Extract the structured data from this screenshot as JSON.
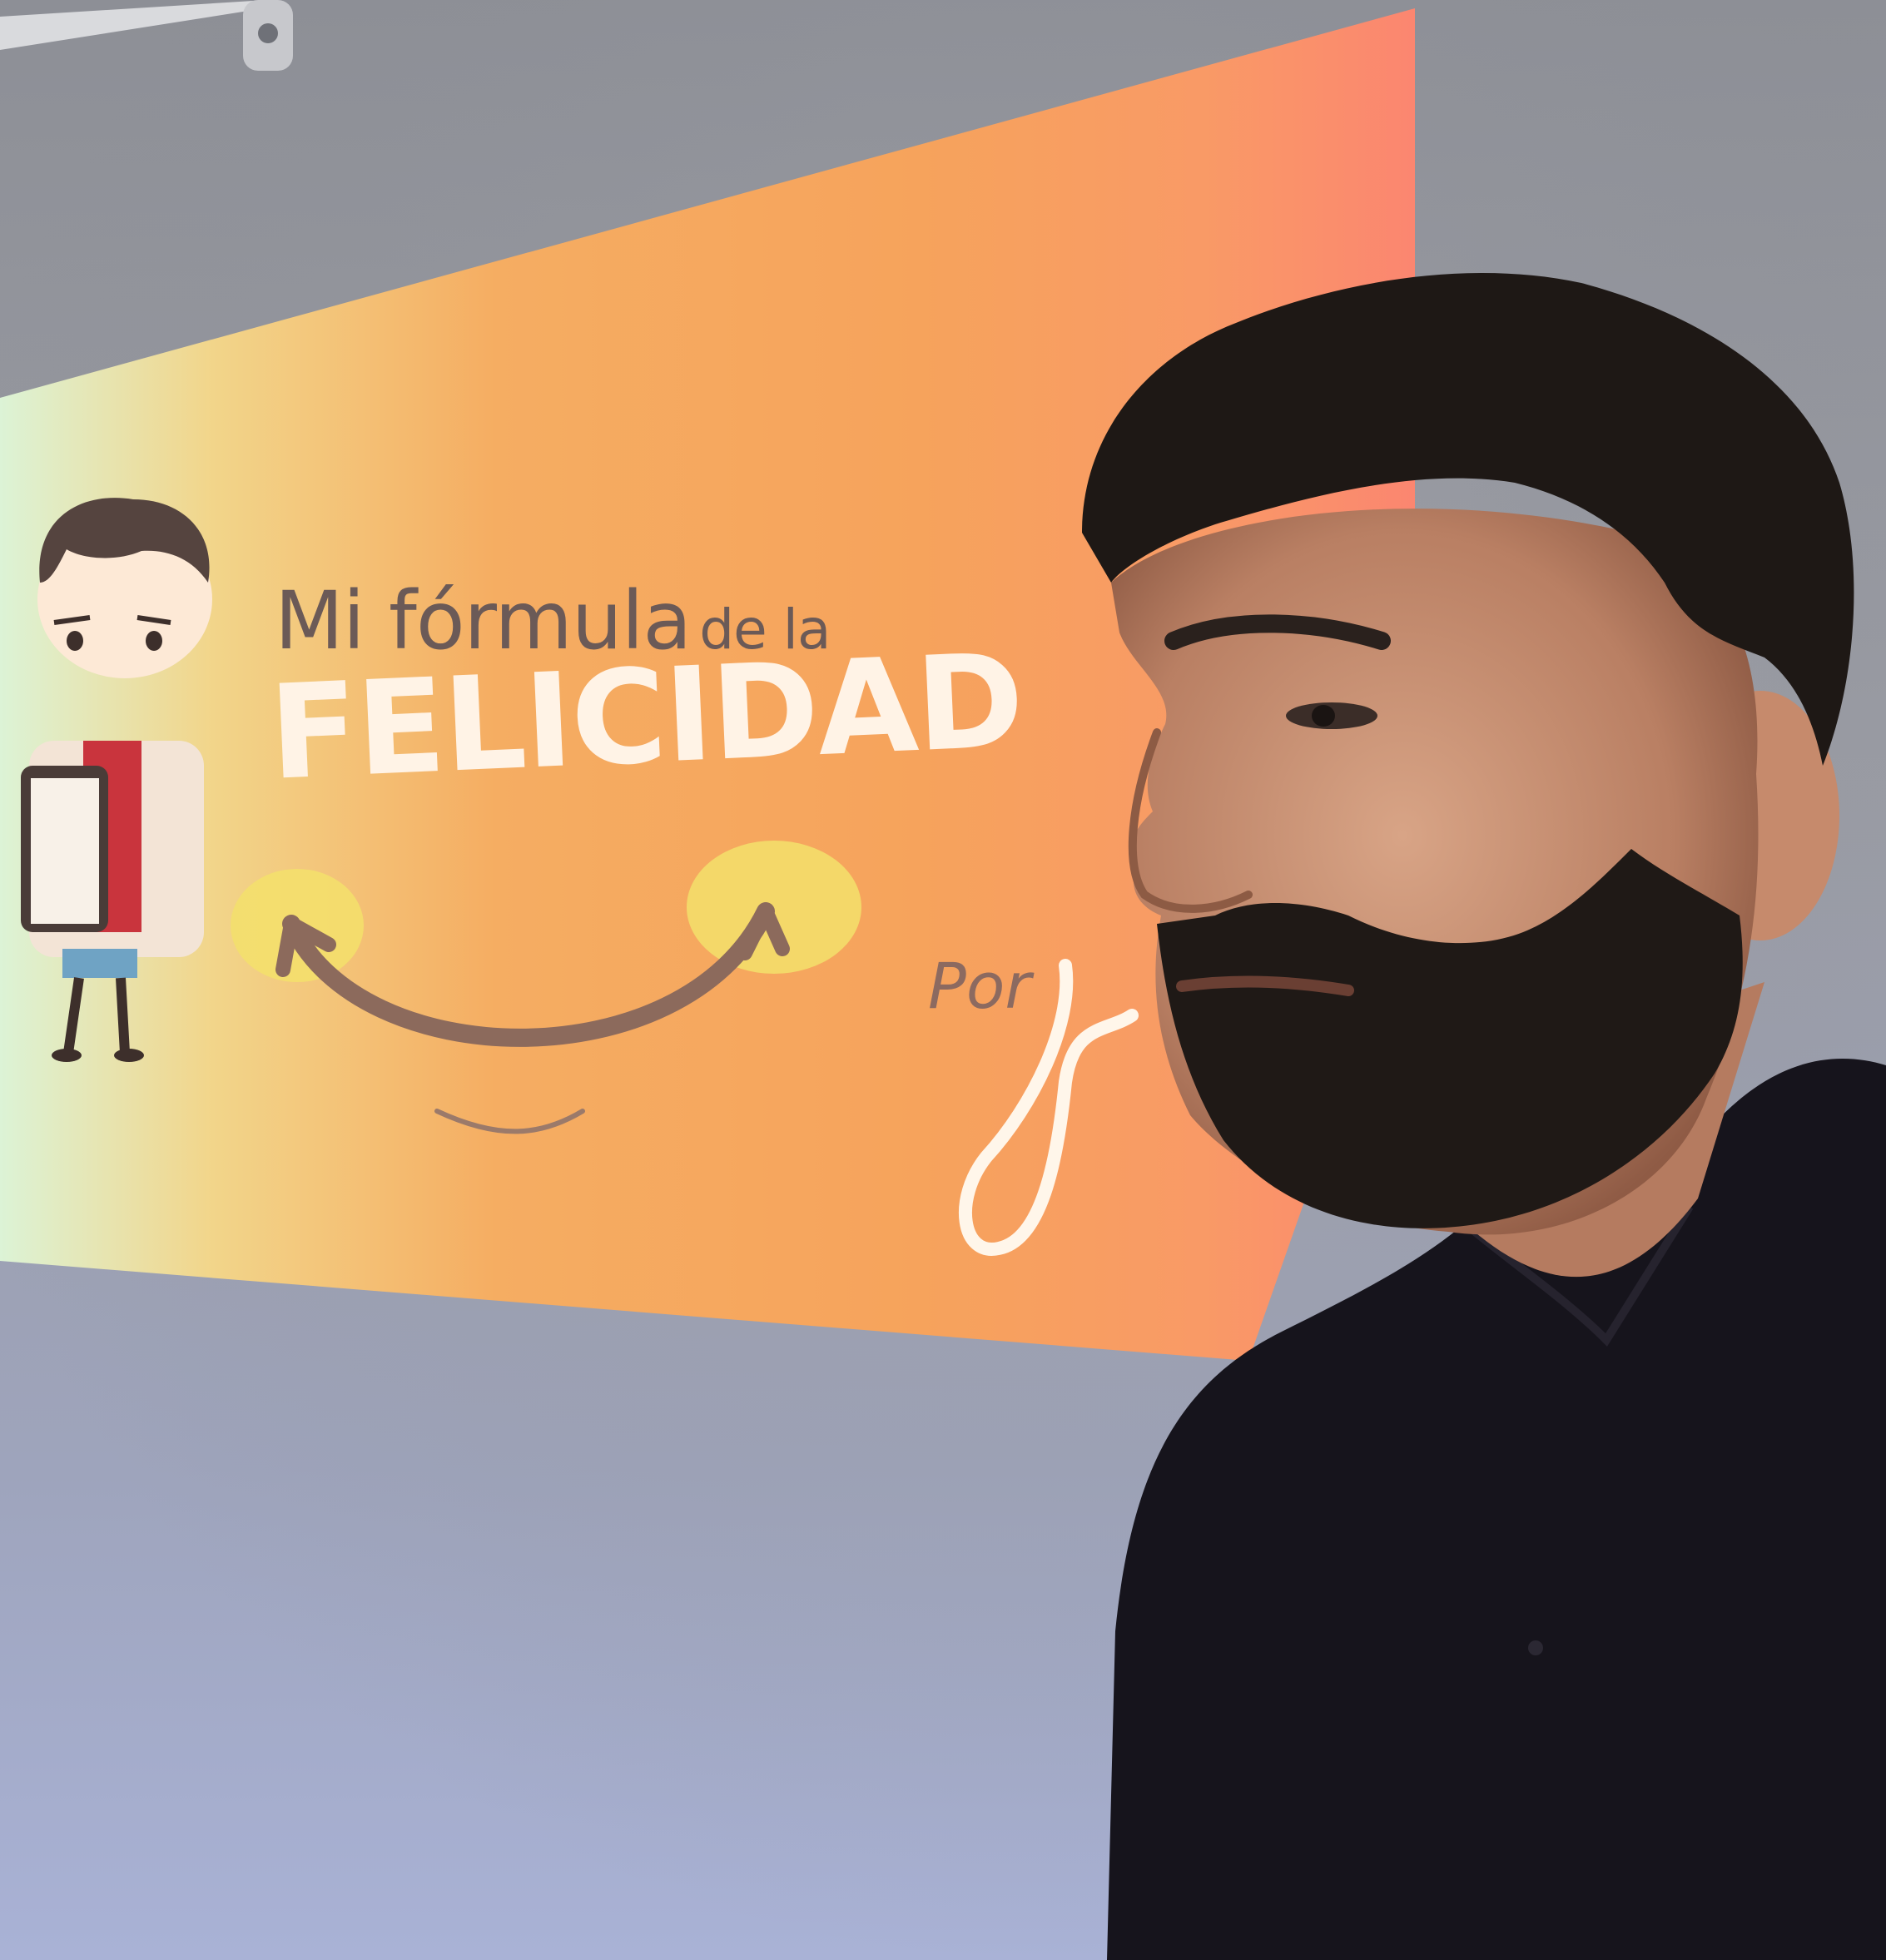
{
  "slide": {
    "title_prefix": "Mi fórmula",
    "title_suffix": "de la",
    "title_main": "FELICIDAD",
    "byline": "Por"
  },
  "colors": {
    "wall": "#9a9ca4",
    "slide_left": "#dff2d2",
    "slide_middle": "#f5a35a",
    "slide_right": "#f98a6e",
    "shirt": "#15131c",
    "hair": "#1e1815",
    "skin": "#c99477"
  },
  "icons": {
    "character": "cartoon-character-icon",
    "smile": "smile-arrow-icon",
    "signature": "handwritten-signature-icon"
  }
}
